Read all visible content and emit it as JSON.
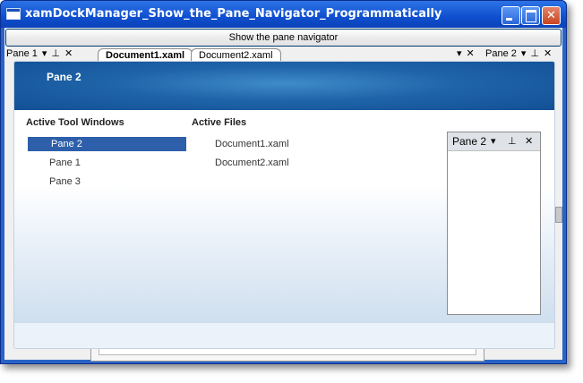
{
  "window": {
    "title": "xamDockManager_Show_the_Pane_Navigator_Programmatically",
    "minimize_glyph": "",
    "maximize_glyph": "",
    "close_glyph": "✕"
  },
  "toolbar": {
    "show_navigator_label": "Show the pane navigator"
  },
  "dock": {
    "left_pane_label": "Pane 1",
    "right_pane_label": "Pane 2",
    "dropdown_glyph": "▾",
    "pin_glyph": "⊥",
    "close_glyph": "✕",
    "tabs": [
      {
        "label": "Document1.xaml"
      },
      {
        "label": "Document2.xaml"
      }
    ]
  },
  "navigator": {
    "header_title": "Pane 2",
    "tool_windows_heading": "Active Tool Windows",
    "files_heading": "Active Files",
    "tool_windows": [
      {
        "label": "Pane 2",
        "selected": true
      },
      {
        "label": "Pane 1",
        "selected": false
      },
      {
        "label": "Pane 3",
        "selected": false
      }
    ],
    "files": [
      {
        "label": "Document1.xaml"
      },
      {
        "label": "Document2.xaml"
      }
    ],
    "preview": {
      "title": "Pane 2",
      "dropdown_glyph": "▾",
      "pin_glyph": "⊥",
      "close_glyph": "✕"
    }
  },
  "colors": {
    "titlebar": "#0f4fcf",
    "selection": "#2e5faa",
    "nav_header": "#1f64a8"
  }
}
